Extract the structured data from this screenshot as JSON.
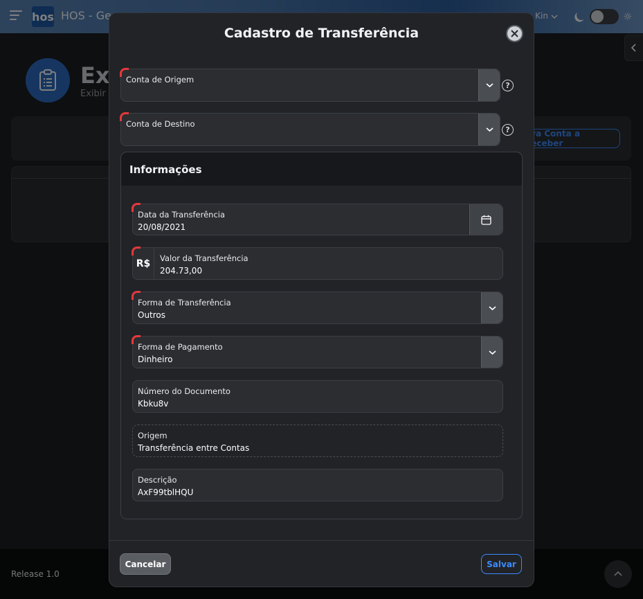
{
  "app": {
    "logo_text": "hos",
    "title": "HOS - Ge",
    "user_name": "o Kin"
  },
  "page": {
    "title": "Exi",
    "subtitle": "Exibir E",
    "new_button_label": "ova Conta a Receber"
  },
  "modal": {
    "title": "Cadastro de Transferência",
    "origin_account": {
      "label": "Conta de Origem",
      "value": ""
    },
    "destination_account": {
      "label": "Conta de Destino",
      "value": ""
    },
    "info": {
      "title": "Informações",
      "transfer_date": {
        "label": "Data da Transferência",
        "value": "20/08/2021"
      },
      "transfer_value": {
        "label": "Valor da Transferência",
        "value": "204.73,00",
        "prefix": "R$"
      },
      "transfer_form": {
        "label": "Forma de Transferência",
        "value": "Outros"
      },
      "payment_form": {
        "label": "Forma de Pagamento",
        "value": "Dinheiro"
      },
      "document_number": {
        "label": "Número do Documento",
        "value": "Kbku8v"
      },
      "origin": {
        "label": "Origem",
        "value": "Transferência entre Contas"
      },
      "description": {
        "label": "Descrição",
        "value": "AxF99tblHQU"
      }
    },
    "cancel_label": "Cancelar",
    "save_label": "Salvar"
  },
  "footer": {
    "release": "Release 1.0"
  },
  "colors": {
    "accent": "#3d8bfd",
    "required": "#e5383b",
    "header_gradient": "#4a77ad"
  },
  "icons": [
    "menu-icon",
    "chevron-down-icon",
    "moon-icon",
    "sun-icon",
    "clipboard-icon",
    "chevron-left-icon",
    "close-icon",
    "help-icon",
    "calendar-icon",
    "chevron-up-icon"
  ]
}
